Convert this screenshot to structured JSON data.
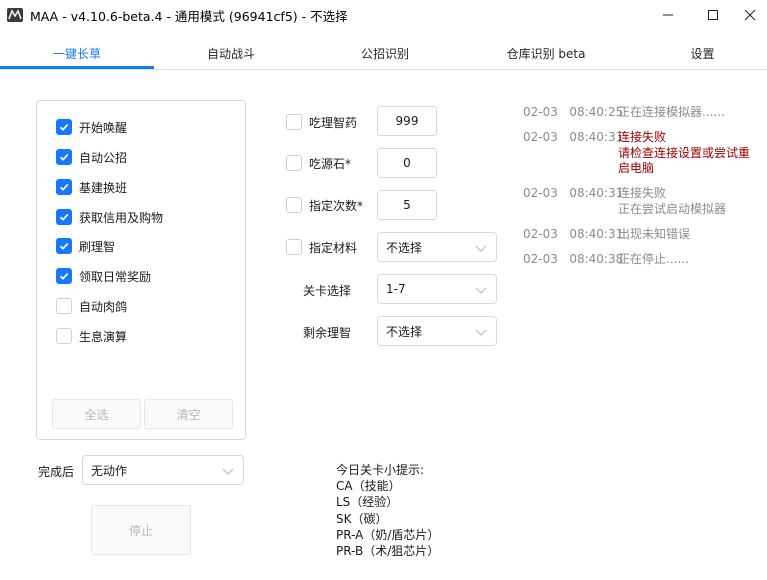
{
  "window": {
    "title": "MAA - v4.10.6-beta.4 - 通用模式 (96941cf5) - 不选择"
  },
  "tabs": [
    {
      "label": "一键长草",
      "active": true
    },
    {
      "label": "自动战斗",
      "active": false
    },
    {
      "label": "公招识别",
      "active": false
    },
    {
      "label": "仓库识别 beta",
      "active": false
    },
    {
      "label": "设置",
      "active": false
    }
  ],
  "tasks": [
    {
      "label": "开始唤醒",
      "checked": true
    },
    {
      "label": "自动公招",
      "checked": true
    },
    {
      "label": "基建换班",
      "checked": true
    },
    {
      "label": "获取信用及购物",
      "checked": true
    },
    {
      "label": "刷理智",
      "checked": true
    },
    {
      "label": "领取日常奖励",
      "checked": true
    },
    {
      "label": "自动肉鸽",
      "checked": false
    },
    {
      "label": "生息演算",
      "checked": false
    }
  ],
  "task_buttons": {
    "select_all": "全选",
    "clear": "清空"
  },
  "after_finish": {
    "label": "完成后",
    "value": "无动作"
  },
  "stop_button": "停止",
  "options": {
    "medicine": {
      "label": "吃理智药",
      "checked": false,
      "value": "999"
    },
    "stone": {
      "label": "吃源石*",
      "checked": false,
      "value": "0"
    },
    "times": {
      "label": "指定次数*",
      "checked": false,
      "value": "5"
    },
    "material": {
      "label": "指定材料",
      "checked": false,
      "value": "不选择"
    },
    "stage": {
      "label": "关卡选择",
      "value": "1-7"
    },
    "remaining": {
      "label": "剩余理智",
      "value": "不选择"
    }
  },
  "tips": {
    "title": "今日关卡小提示:",
    "lines": [
      "CA（技能）",
      "LS（经验）",
      "SK（碳）",
      "PR-A（奶/盾芯片）",
      "PR-B（术/狙芯片）"
    ]
  },
  "logs": [
    {
      "date": "02-03",
      "time": "08:40:25",
      "lines": [
        "正在连接模拟器......"
      ],
      "type": "info"
    },
    {
      "date": "02-03",
      "time": "08:40:31",
      "lines": [
        "连接失败",
        "请检查连接设置或尝试重",
        "启电脑"
      ],
      "type": "error"
    },
    {
      "date": "02-03",
      "time": "08:40:31",
      "lines": [
        "连接失败",
        "正在尝试启动模拟器"
      ],
      "type": "info"
    },
    {
      "date": "02-03",
      "time": "08:40:31",
      "lines": [
        "出现未知错误"
      ],
      "type": "info"
    },
    {
      "date": "02-03",
      "time": "08:40:38",
      "lines": [
        "正在停止......"
      ],
      "type": "info"
    }
  ],
  "colors": {
    "accent": "#1677ff",
    "error": "#a30000",
    "muted": "#8c8c8c"
  }
}
